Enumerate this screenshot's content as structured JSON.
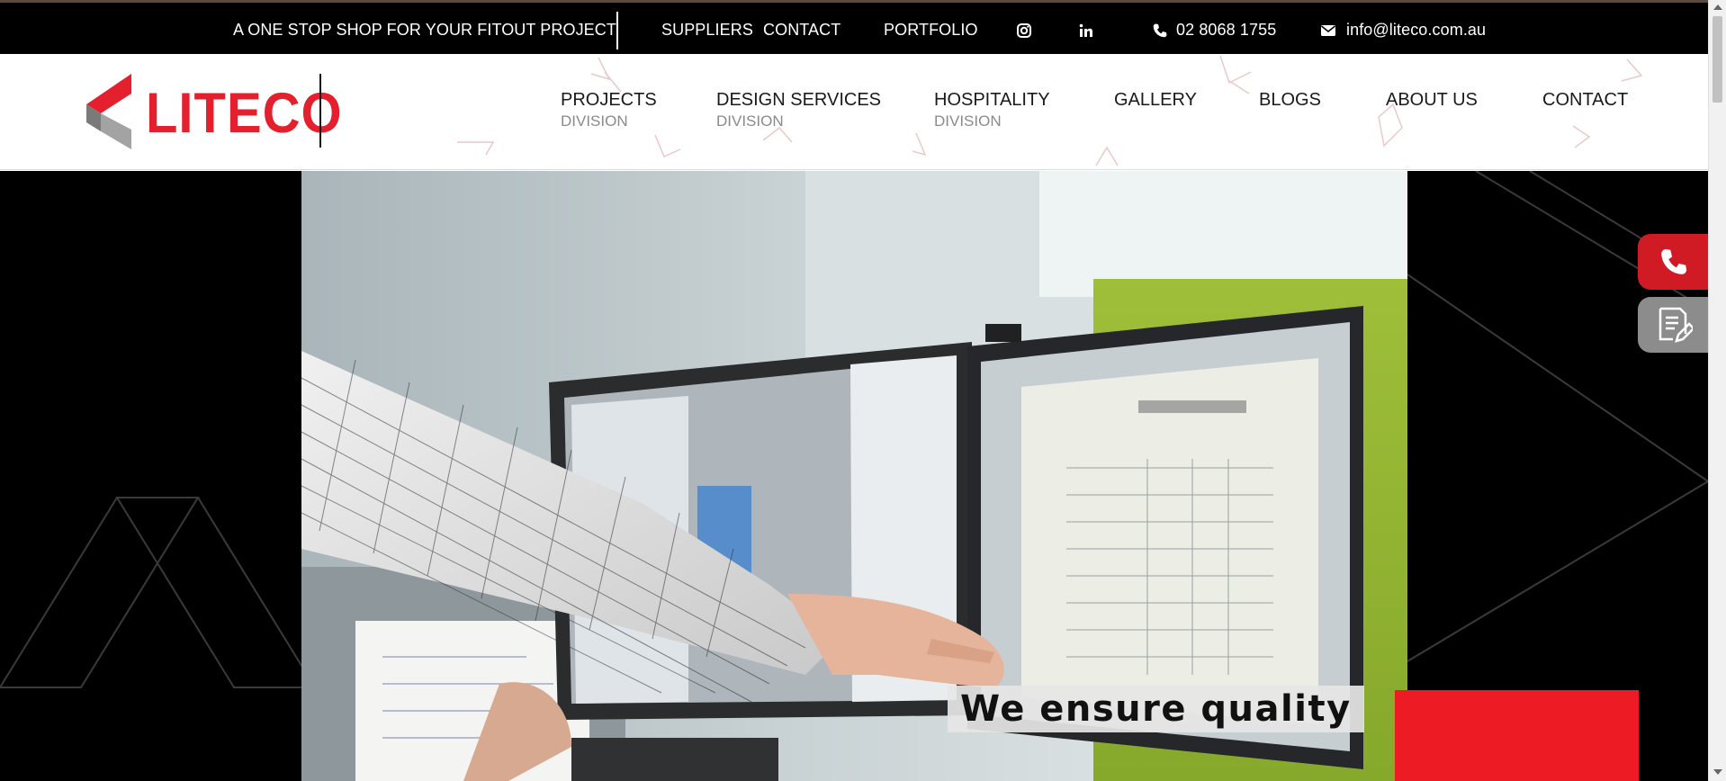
{
  "topbar": {
    "tagline": "A ONE STOP SHOP FOR YOUR FITOUT PROJECT",
    "links": [
      "SUPPLIERS",
      "CONTACT",
      "PORTFOLIO"
    ],
    "social": [
      "instagram-icon",
      "linkedin-icon"
    ],
    "phone": "02 8068 1755",
    "email": "info@liteco.com.au"
  },
  "brand": {
    "name": "LITECO",
    "color": "#e5202e"
  },
  "nav": [
    {
      "label": "PROJECTS",
      "sub": "DIVISION"
    },
    {
      "label": "DESIGN SERVICES",
      "sub": "DIVISION"
    },
    {
      "label": "HOSPITALITY",
      "sub": "DIVISION"
    },
    {
      "label": "GALLERY"
    },
    {
      "label": "BLOGS"
    },
    {
      "label": "ABOUT US"
    },
    {
      "label": "CONTACT"
    }
  ],
  "hero": {
    "caption": "We ensure quality",
    "accent": "#ed1c24"
  },
  "floating": {
    "call_icon": "phone-icon",
    "quote_icon": "quote-form-icon",
    "call_color": "#d11b24",
    "quote_color": "#8c8c8c"
  }
}
